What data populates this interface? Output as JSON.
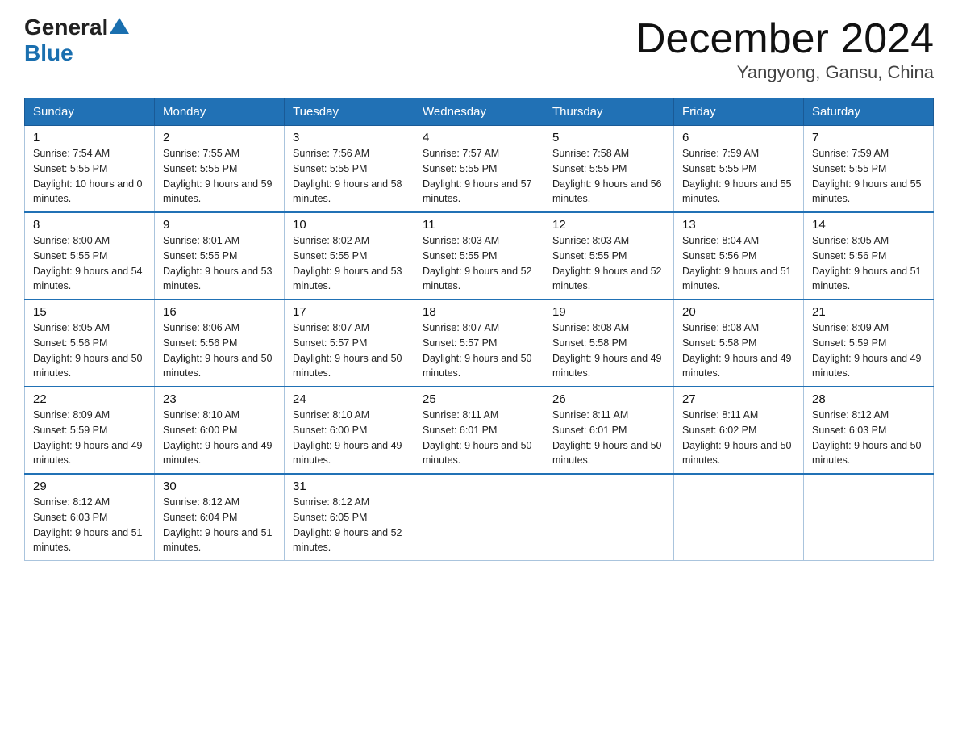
{
  "logo": {
    "general": "General",
    "blue": "Blue"
  },
  "title": "December 2024",
  "location": "Yangyong, Gansu, China",
  "days_of_week": [
    "Sunday",
    "Monday",
    "Tuesday",
    "Wednesday",
    "Thursday",
    "Friday",
    "Saturday"
  ],
  "weeks": [
    [
      {
        "day": "1",
        "sunrise": "7:54 AM",
        "sunset": "5:55 PM",
        "daylight": "10 hours and 0 minutes."
      },
      {
        "day": "2",
        "sunrise": "7:55 AM",
        "sunset": "5:55 PM",
        "daylight": "9 hours and 59 minutes."
      },
      {
        "day": "3",
        "sunrise": "7:56 AM",
        "sunset": "5:55 PM",
        "daylight": "9 hours and 58 minutes."
      },
      {
        "day": "4",
        "sunrise": "7:57 AM",
        "sunset": "5:55 PM",
        "daylight": "9 hours and 57 minutes."
      },
      {
        "day": "5",
        "sunrise": "7:58 AM",
        "sunset": "5:55 PM",
        "daylight": "9 hours and 56 minutes."
      },
      {
        "day": "6",
        "sunrise": "7:59 AM",
        "sunset": "5:55 PM",
        "daylight": "9 hours and 55 minutes."
      },
      {
        "day": "7",
        "sunrise": "7:59 AM",
        "sunset": "5:55 PM",
        "daylight": "9 hours and 55 minutes."
      }
    ],
    [
      {
        "day": "8",
        "sunrise": "8:00 AM",
        "sunset": "5:55 PM",
        "daylight": "9 hours and 54 minutes."
      },
      {
        "day": "9",
        "sunrise": "8:01 AM",
        "sunset": "5:55 PM",
        "daylight": "9 hours and 53 minutes."
      },
      {
        "day": "10",
        "sunrise": "8:02 AM",
        "sunset": "5:55 PM",
        "daylight": "9 hours and 53 minutes."
      },
      {
        "day": "11",
        "sunrise": "8:03 AM",
        "sunset": "5:55 PM",
        "daylight": "9 hours and 52 minutes."
      },
      {
        "day": "12",
        "sunrise": "8:03 AM",
        "sunset": "5:55 PM",
        "daylight": "9 hours and 52 minutes."
      },
      {
        "day": "13",
        "sunrise": "8:04 AM",
        "sunset": "5:56 PM",
        "daylight": "9 hours and 51 minutes."
      },
      {
        "day": "14",
        "sunrise": "8:05 AM",
        "sunset": "5:56 PM",
        "daylight": "9 hours and 51 minutes."
      }
    ],
    [
      {
        "day": "15",
        "sunrise": "8:05 AM",
        "sunset": "5:56 PM",
        "daylight": "9 hours and 50 minutes."
      },
      {
        "day": "16",
        "sunrise": "8:06 AM",
        "sunset": "5:56 PM",
        "daylight": "9 hours and 50 minutes."
      },
      {
        "day": "17",
        "sunrise": "8:07 AM",
        "sunset": "5:57 PM",
        "daylight": "9 hours and 50 minutes."
      },
      {
        "day": "18",
        "sunrise": "8:07 AM",
        "sunset": "5:57 PM",
        "daylight": "9 hours and 50 minutes."
      },
      {
        "day": "19",
        "sunrise": "8:08 AM",
        "sunset": "5:58 PM",
        "daylight": "9 hours and 49 minutes."
      },
      {
        "day": "20",
        "sunrise": "8:08 AM",
        "sunset": "5:58 PM",
        "daylight": "9 hours and 49 minutes."
      },
      {
        "day": "21",
        "sunrise": "8:09 AM",
        "sunset": "5:59 PM",
        "daylight": "9 hours and 49 minutes."
      }
    ],
    [
      {
        "day": "22",
        "sunrise": "8:09 AM",
        "sunset": "5:59 PM",
        "daylight": "9 hours and 49 minutes."
      },
      {
        "day": "23",
        "sunrise": "8:10 AM",
        "sunset": "6:00 PM",
        "daylight": "9 hours and 49 minutes."
      },
      {
        "day": "24",
        "sunrise": "8:10 AM",
        "sunset": "6:00 PM",
        "daylight": "9 hours and 49 minutes."
      },
      {
        "day": "25",
        "sunrise": "8:11 AM",
        "sunset": "6:01 PM",
        "daylight": "9 hours and 50 minutes."
      },
      {
        "day": "26",
        "sunrise": "8:11 AM",
        "sunset": "6:01 PM",
        "daylight": "9 hours and 50 minutes."
      },
      {
        "day": "27",
        "sunrise": "8:11 AM",
        "sunset": "6:02 PM",
        "daylight": "9 hours and 50 minutes."
      },
      {
        "day": "28",
        "sunrise": "8:12 AM",
        "sunset": "6:03 PM",
        "daylight": "9 hours and 50 minutes."
      }
    ],
    [
      {
        "day": "29",
        "sunrise": "8:12 AM",
        "sunset": "6:03 PM",
        "daylight": "9 hours and 51 minutes."
      },
      {
        "day": "30",
        "sunrise": "8:12 AM",
        "sunset": "6:04 PM",
        "daylight": "9 hours and 51 minutes."
      },
      {
        "day": "31",
        "sunrise": "8:12 AM",
        "sunset": "6:05 PM",
        "daylight": "9 hours and 52 minutes."
      },
      null,
      null,
      null,
      null
    ]
  ]
}
